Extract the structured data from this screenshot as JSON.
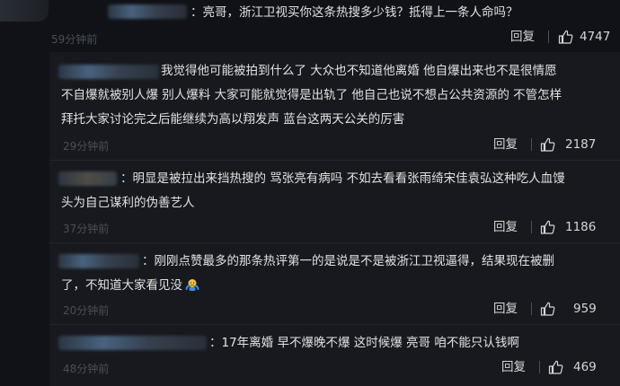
{
  "comments": [
    {
      "prefix": "：",
      "text": "亮哥，浙江卫视买你这条热搜多少钱？抵得上一条人命吗？",
      "time": "59分钟前",
      "reply_label": "回复",
      "likes": "4747"
    }
  ],
  "replies": [
    {
      "lines": [
        "我觉得他可能被拍到什么了 大众也不知道他离婚 他自爆出来也不是很情愿",
        "不自爆就被别人爆 别人爆料 大家可能就觉得是出轨了 他自己也说不想占公共资源的 不管怎样",
        "拜托大家讨论完之后能继续为高以翔发声 蓝台这两天公关的厉害"
      ],
      "time": "29分钟前",
      "reply_label": "回复",
      "likes": "2187"
    },
    {
      "prefix": "：",
      "lines": [
        "明显是被拉出来挡热搜的  骂张亮有病吗 不如去看看张雨绮宋佳袁弘这种吃人血馒",
        "头为自己谋利的伪善艺人"
      ],
      "time": "37分钟前",
      "reply_label": "回复",
      "likes": "1186"
    },
    {
      "prefix": "：",
      "lines": [
        "刚刚点赞最多的那条热评第一的是说是不是被浙江卫视逼得，结果现在被删",
        "了，不知道大家看见没"
      ],
      "emoji": "shrug-emoji",
      "time": "20分钟前",
      "reply_label": "回复",
      "likes": "959"
    },
    {
      "prefix": "：",
      "lines": [
        "17年离婚 早不爆晚不爆 这时候爆 亮哥 咱不能只认钱啊"
      ],
      "time": "48分钟前",
      "reply_label": "回复",
      "likes": "469"
    }
  ],
  "colors": {
    "background": "#101217",
    "reply_panel": "#17191e",
    "text": "#e2e2e2",
    "muted": "#4a4f57"
  },
  "icons": {
    "like": "thumbs-up-icon",
    "emoji": "shrug-emoji"
  }
}
